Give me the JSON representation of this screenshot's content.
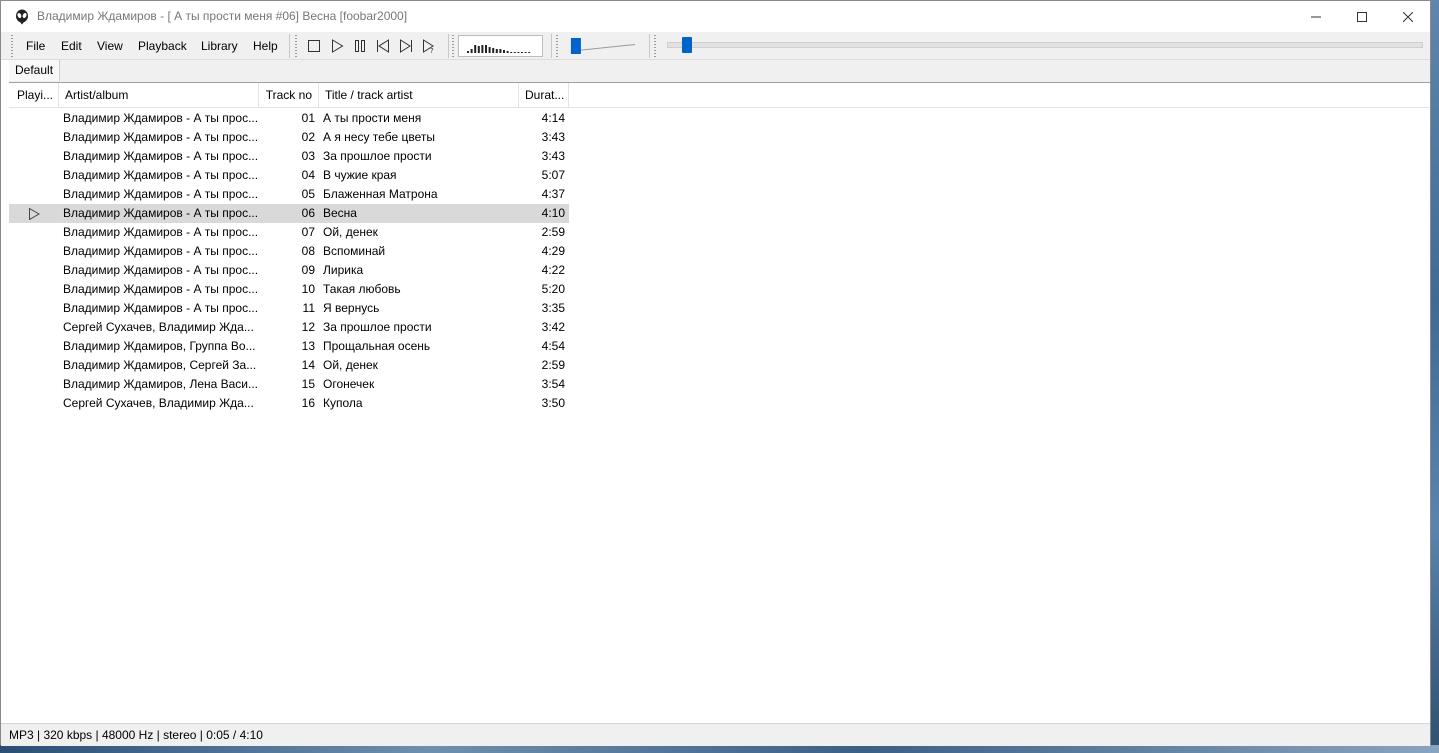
{
  "window": {
    "title": "Владимир Ждамиров - [ А ты прости меня #06] Весна  [foobar2000]"
  },
  "menu": [
    {
      "label": "File"
    },
    {
      "label": "Edit"
    },
    {
      "label": "View"
    },
    {
      "label": "Playback"
    },
    {
      "label": "Library"
    },
    {
      "label": "Help"
    }
  ],
  "toolbar": {
    "buttons": [
      "stop-icon",
      "play-icon",
      "pause-icon",
      "previous-icon",
      "next-icon",
      "random-icon"
    ],
    "volume_level": 0.05,
    "seek_position": 0.02
  },
  "visualizer": {
    "levels": [
      0.15,
      0.3,
      0.55,
      0.5,
      0.6,
      0.55,
      0.4,
      0.35,
      0.3,
      0.25,
      0.2,
      0.15,
      0.1,
      0.08,
      0.06,
      0.05,
      0.05,
      0.04
    ]
  },
  "tabs": [
    {
      "label": "Default"
    }
  ],
  "columns": [
    {
      "label": "Playi..."
    },
    {
      "label": "Artist/album"
    },
    {
      "label": "Track no"
    },
    {
      "label": "Title / track artist"
    },
    {
      "label": "Durat..."
    }
  ],
  "tracks": [
    {
      "artist": "Владимир Ждамиров -  А ты прос...",
      "no": "01",
      "title": "А ты прости меня",
      "duration": "4:14",
      "playing": false
    },
    {
      "artist": "Владимир Ждамиров -  А ты прос...",
      "no": "02",
      "title": "А я несу тебе цветы",
      "duration": "3:43",
      "playing": false
    },
    {
      "artist": "Владимир Ждамиров -  А ты прос...",
      "no": "03",
      "title": "За прошлое прости",
      "duration": "3:43",
      "playing": false
    },
    {
      "artist": "Владимир Ждамиров -  А ты прос...",
      "no": "04",
      "title": "В чужие края",
      "duration": "5:07",
      "playing": false
    },
    {
      "artist": "Владимир Ждамиров -  А ты прос...",
      "no": "05",
      "title": "Блаженная Матрона",
      "duration": "4:37",
      "playing": false
    },
    {
      "artist": "Владимир Ждамиров -  А ты прос...",
      "no": "06",
      "title": "Весна",
      "duration": "4:10",
      "playing": true
    },
    {
      "artist": "Владимир Ждамиров -  А ты прос...",
      "no": "07",
      "title": "Ой, денек",
      "duration": "2:59",
      "playing": false
    },
    {
      "artist": "Владимир Ждамиров -  А ты прос...",
      "no": "08",
      "title": "Вспоминай",
      "duration": "4:29",
      "playing": false
    },
    {
      "artist": "Владимир Ждамиров -  А ты прос...",
      "no": "09",
      "title": "Лирика",
      "duration": "4:22",
      "playing": false
    },
    {
      "artist": "Владимир Ждамиров -  А ты прос...",
      "no": "10",
      "title": "Такая любовь",
      "duration": "5:20",
      "playing": false
    },
    {
      "artist": "Владимир Ждамиров -  А ты прос...",
      "no": "11",
      "title": "Я вернусь",
      "duration": "3:35",
      "playing": false
    },
    {
      "artist": "Сергей Сухачев, Владимир Жда...",
      "no": "12",
      "title": "За прошлое прости",
      "duration": "3:42",
      "playing": false
    },
    {
      "artist": "Владимир Ждамиров, Группа Во...",
      "no": "13",
      "title": "Прощальная осень",
      "duration": "4:54",
      "playing": false
    },
    {
      "artist": "Владимир Ждамиров, Сергей За...",
      "no": "14",
      "title": "Ой, денек",
      "duration": "2:59",
      "playing": false
    },
    {
      "artist": "Владимир Ждамиров, Лена Васи...",
      "no": "15",
      "title": "Огонечек",
      "duration": "3:54",
      "playing": false
    },
    {
      "artist": "Сергей Сухачев, Владимир Жда...",
      "no": "16",
      "title": "Купола",
      "duration": "3:50",
      "playing": false
    }
  ],
  "status": {
    "text": "MP3 | 320 kbps | 48000 Hz | stereo | 0:05 / 4:10"
  },
  "colors": {
    "accent": "#0063c9",
    "selected_row": "#d9d9d9"
  }
}
